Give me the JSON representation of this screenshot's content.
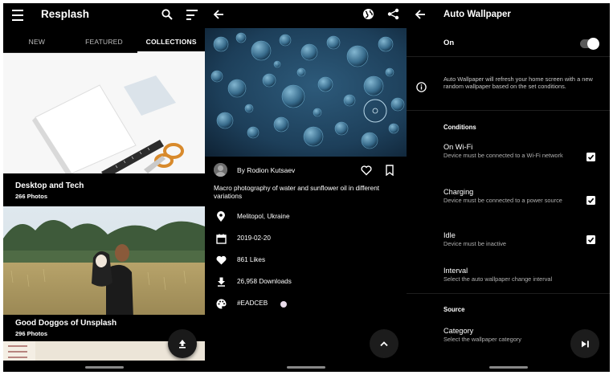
{
  "collections_screen": {
    "app_title": "Resplash",
    "icons": {
      "menu": "menu-icon",
      "search": "search-icon",
      "sort": "sort-icon",
      "upload": "upload-icon"
    },
    "tabs": [
      {
        "label": "NEW",
        "active": false
      },
      {
        "label": "FEATURED",
        "active": false
      },
      {
        "label": "COLLECTIONS",
        "active": true
      }
    ],
    "collections": [
      {
        "title": "Desktop and Tech",
        "count": "266 Photos"
      },
      {
        "title": "Good Doggos of Unsplash",
        "count": "296 Photos"
      }
    ]
  },
  "photo_screen": {
    "icons": {
      "back": "back-icon",
      "globe": "globe-icon",
      "share": "share-icon",
      "like": "heart-icon",
      "collect": "bookmark-icon",
      "scroll_up": "chevron-up-icon"
    },
    "author": "By Rodion Kutsaev",
    "description": "Macro photography of water and sunflower oil in different variations",
    "location": "Melitopol, Ukraine",
    "date": "2019-02-20",
    "likes": "861 Likes",
    "downloads": "26,958 Downloads",
    "color": "#EADCEB",
    "color_swatch": "#eadceb"
  },
  "wallpaper_screen": {
    "title": "Auto Wallpaper",
    "toggle_label": "On",
    "toggle_on": true,
    "info": "Auto Wallpaper will refresh your home screen with a new random wallpaper based on the set conditions.",
    "conditions_header": "Conditions",
    "conditions": [
      {
        "title": "On Wi-Fi",
        "subtitle": "Device must be connected to a Wi-Fi network",
        "checked": true
      },
      {
        "title": "Charging",
        "subtitle": "Device must be connected to a power source",
        "checked": true
      },
      {
        "title": "Idle",
        "subtitle": "Device must be inactive",
        "checked": true
      }
    ],
    "interval": {
      "title": "Interval",
      "subtitle": "Select the auto wallpaper change interval"
    },
    "source_header": "Source",
    "category": {
      "title": "Category",
      "subtitle": "Select the wallpaper category"
    }
  }
}
